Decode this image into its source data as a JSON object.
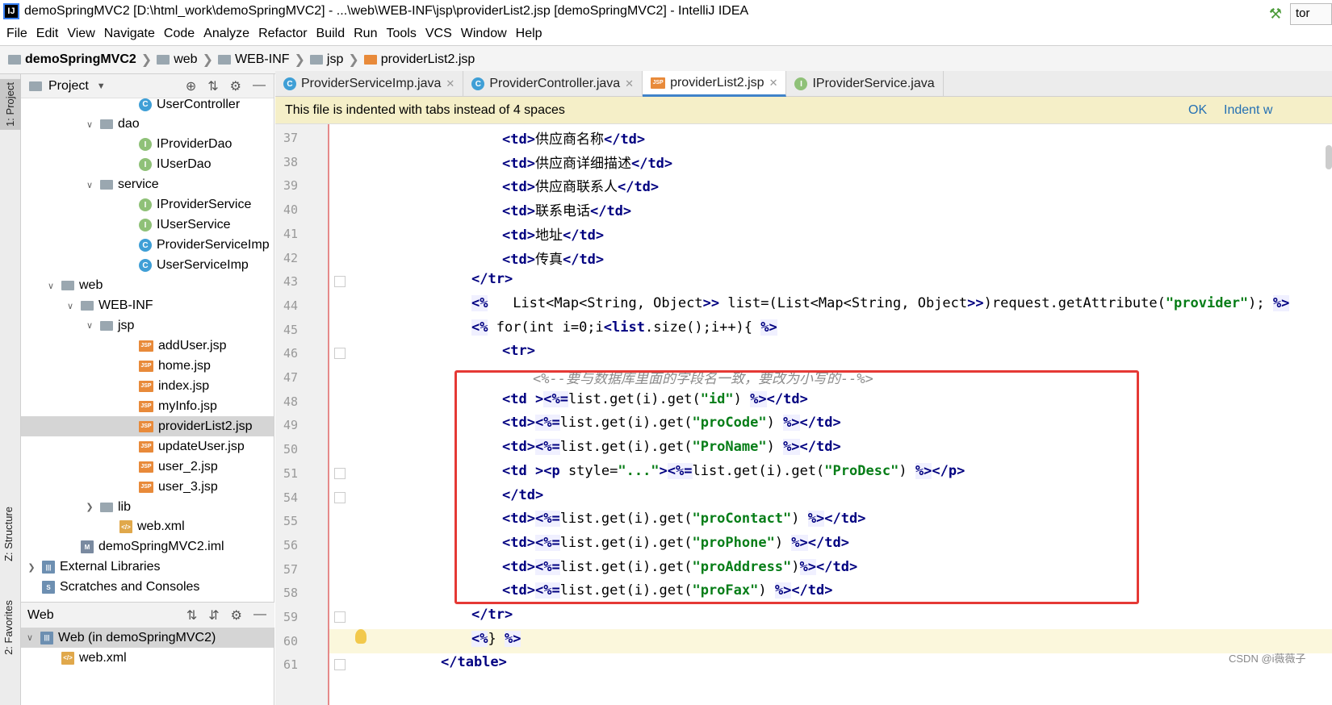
{
  "window": {
    "title": "demoSpringMVC2 [D:\\html_work\\demoSpringMVC2] - ...\\web\\WEB-INF\\jsp\\providerList2.jsp [demoSpringMVC2] - IntelliJ IDEA",
    "app_icon": "IJ"
  },
  "menu": [
    "File",
    "Edit",
    "View",
    "Navigate",
    "Code",
    "Analyze",
    "Refactor",
    "Build",
    "Run",
    "Tools",
    "VCS",
    "Window",
    "Help"
  ],
  "breadcrumb": [
    "demoSpringMVC2",
    "web",
    "WEB-INF",
    "jsp",
    "providerList2.jsp"
  ],
  "run_config": "tor",
  "side_tabs": {
    "project": "1: Project",
    "structure": "Z: Structure",
    "favorites": "2: Favorites"
  },
  "project_panel": {
    "title": "Project",
    "tree": [
      {
        "label": "UserController",
        "icon": "class",
        "depth": 5,
        "arrow": ""
      },
      {
        "label": "dao",
        "icon": "folder",
        "depth": 3,
        "arrow": "v"
      },
      {
        "label": "IProviderDao",
        "icon": "interface",
        "depth": 5,
        "arrow": ""
      },
      {
        "label": "IUserDao",
        "icon": "interface",
        "depth": 5,
        "arrow": ""
      },
      {
        "label": "service",
        "icon": "folder",
        "depth": 3,
        "arrow": "v"
      },
      {
        "label": "IProviderService",
        "icon": "interface",
        "depth": 5,
        "arrow": ""
      },
      {
        "label": "IUserService",
        "icon": "interface",
        "depth": 5,
        "arrow": ""
      },
      {
        "label": "ProviderServiceImp",
        "icon": "class",
        "depth": 5,
        "arrow": ""
      },
      {
        "label": "UserServiceImp",
        "icon": "class",
        "depth": 5,
        "arrow": ""
      },
      {
        "label": "web",
        "icon": "folder",
        "depth": 1,
        "arrow": "v"
      },
      {
        "label": "WEB-INF",
        "icon": "folder",
        "depth": 2,
        "arrow": "v"
      },
      {
        "label": "jsp",
        "icon": "folder",
        "depth": 3,
        "arrow": "v"
      },
      {
        "label": "addUser.jsp",
        "icon": "jsp",
        "depth": 5,
        "arrow": ""
      },
      {
        "label": "home.jsp",
        "icon": "jsp",
        "depth": 5,
        "arrow": ""
      },
      {
        "label": "index.jsp",
        "icon": "jsp",
        "depth": 5,
        "arrow": ""
      },
      {
        "label": "myInfo.jsp",
        "icon": "jsp",
        "depth": 5,
        "arrow": ""
      },
      {
        "label": "providerList2.jsp",
        "icon": "jsp",
        "depth": 5,
        "arrow": "",
        "selected": true
      },
      {
        "label": "updateUser.jsp",
        "icon": "jsp",
        "depth": 5,
        "arrow": ""
      },
      {
        "label": "user_2.jsp",
        "icon": "jsp",
        "depth": 5,
        "arrow": ""
      },
      {
        "label": "user_3.jsp",
        "icon": "jsp",
        "depth": 5,
        "arrow": ""
      },
      {
        "label": "lib",
        "icon": "folder",
        "depth": 3,
        "arrow": ">"
      },
      {
        "label": "web.xml",
        "icon": "xml",
        "depth": 4,
        "arrow": ""
      },
      {
        "label": "demoSpringMVC2.iml",
        "icon": "iml",
        "depth": 2,
        "arrow": ""
      },
      {
        "label": "External Libraries",
        "icon": "lib",
        "depth": 0,
        "arrow": ">"
      },
      {
        "label": "Scratches and Consoles",
        "icon": "scratch",
        "depth": 0,
        "arrow": ""
      }
    ]
  },
  "web_panel": {
    "title": "Web",
    "tree": [
      {
        "label": "Web (in demoSpringMVC2)",
        "arrow": "v",
        "selected": true
      },
      {
        "label": "web.xml",
        "arrow": ""
      }
    ]
  },
  "editor_tabs": [
    {
      "label": "ProviderServiceImp.java",
      "icon": "class",
      "active": false
    },
    {
      "label": "ProviderController.java",
      "icon": "class",
      "active": false
    },
    {
      "label": "providerList2.jsp",
      "icon": "jsp",
      "active": true
    },
    {
      "label": "IProviderService.java",
      "icon": "interface",
      "active": false
    }
  ],
  "notice": {
    "text": "This file is indented with tabs instead of 4 spaces",
    "ok": "OK",
    "indent": "Indent w"
  },
  "code_lines": [
    {
      "n": "37",
      "text": "<td>供应商名称</td>",
      "indent": 3
    },
    {
      "n": "38",
      "text": "<td>供应商详细描述</td>",
      "indent": 3
    },
    {
      "n": "39",
      "text": "<td>供应商联系人</td>",
      "indent": 3
    },
    {
      "n": "40",
      "text": "<td>联系电话</td>",
      "indent": 3
    },
    {
      "n": "41",
      "text": "<td>地址</td>",
      "indent": 3
    },
    {
      "n": "42",
      "text": "<td>传真</td>",
      "indent": 3
    },
    {
      "n": "43",
      "text": "</tr>",
      "indent": 2
    },
    {
      "n": "44",
      "text": "<%   List<Map<String, Object>> list=(List<Map<String, Object>>)request.getAttribute(\"provider\"); %>",
      "indent": 2
    },
    {
      "n": "45",
      "text": "<% for(int i=0;i<list.size();i++){ %>",
      "indent": 2
    },
    {
      "n": "46",
      "text": "<tr>",
      "indent": 3
    },
    {
      "n": "47",
      "text": "<%--要与数据库里面的字段名一致，要改为小写的--%>",
      "indent": 4
    },
    {
      "n": "48",
      "text": "<td ><%=list.get(i).get(\"id\") %></td>",
      "indent": 3
    },
    {
      "n": "49",
      "text": "<td><%=list.get(i).get(\"proCode\") %></td>",
      "indent": 3
    },
    {
      "n": "50",
      "text": "<td><%=list.get(i).get(\"ProName\") %></td>",
      "indent": 3
    },
    {
      "n": "51",
      "text": "<td ><p style=\"...\"><%=list.get(i).get(\"ProDesc\") %></p>",
      "indent": 3
    },
    {
      "n": "54",
      "text": "</td>",
      "indent": 3
    },
    {
      "n": "55",
      "text": "<td><%=list.get(i).get(\"proContact\") %></td>",
      "indent": 3
    },
    {
      "n": "56",
      "text": "<td><%=list.get(i).get(\"proPhone\") %></td>",
      "indent": 3
    },
    {
      "n": "57",
      "text": "<td><%=list.get(i).get(\"proAddress\")%></td>",
      "indent": 3
    },
    {
      "n": "58",
      "text": "<td><%=list.get(i).get(\"proFax\") %></td>",
      "indent": 3
    },
    {
      "n": "59",
      "text": "</tr>",
      "indent": 2
    },
    {
      "n": "60",
      "text": "<%} %>",
      "indent": 2
    },
    {
      "n": "61",
      "text": "</table>",
      "indent": 1
    }
  ],
  "watermark": "CSDN @i薇薇子",
  "colors": {
    "tag": "#000080",
    "string": "#067d17",
    "comment": "#8c8c8c",
    "highlight": "#f5efc8",
    "red_box": "#e53935"
  }
}
